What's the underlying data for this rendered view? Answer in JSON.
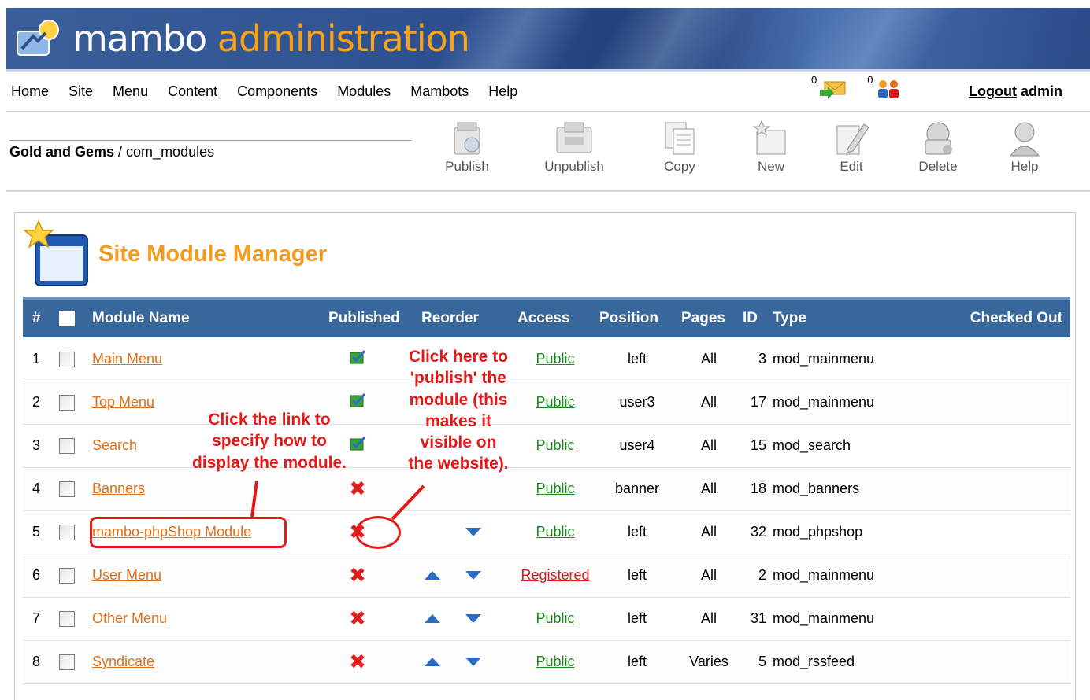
{
  "header": {
    "title_prefix": "mambo ",
    "title_accent": "administration"
  },
  "menu": {
    "items": [
      "Home",
      "Site",
      "Menu",
      "Content",
      "Components",
      "Modules",
      "Mambots",
      "Help"
    ],
    "messages_count": "0",
    "users_count": "0",
    "logout_link": "Logout",
    "logout_user": " admin"
  },
  "pathway": {
    "site": "Gold and Gems",
    "sep": " / ",
    "component": "com_modules"
  },
  "toolbar": {
    "publish": "Publish",
    "unpublish": "Unpublish",
    "copy": "Copy",
    "new": "New",
    "edit": "Edit",
    "delete": "Delete",
    "help": "Help"
  },
  "page_title": "Site Module Manager",
  "table": {
    "headers": {
      "num": "#",
      "name": "Module Name",
      "published": "Published",
      "reorder": "Reorder",
      "access": "Access",
      "position": "Position",
      "pages": "Pages",
      "id": "ID",
      "type": "Type",
      "checked_out": "Checked Out"
    },
    "rows": [
      {
        "num": "1",
        "name": "Main Menu",
        "published": true,
        "up": false,
        "down": false,
        "access": "Public",
        "position": "left",
        "pages": "All",
        "id": "3",
        "type": "mod_mainmenu"
      },
      {
        "num": "2",
        "name": "Top Menu",
        "published": true,
        "up": false,
        "down": false,
        "access": "Public",
        "position": "user3",
        "pages": "All",
        "id": "17",
        "type": "mod_mainmenu"
      },
      {
        "num": "3",
        "name": "Search",
        "published": true,
        "up": false,
        "down": false,
        "access": "Public",
        "position": "user4",
        "pages": "All",
        "id": "15",
        "type": "mod_search"
      },
      {
        "num": "4",
        "name": "Banners",
        "published": false,
        "up": false,
        "down": false,
        "access": "Public",
        "position": "banner",
        "pages": "All",
        "id": "18",
        "type": "mod_banners"
      },
      {
        "num": "5",
        "name": "mambo-phpShop Module",
        "published": false,
        "up": false,
        "down": true,
        "access": "Public",
        "position": "left",
        "pages": "All",
        "id": "32",
        "type": "mod_phpshop"
      },
      {
        "num": "6",
        "name": "User Menu",
        "published": false,
        "up": true,
        "down": true,
        "access": "Registered",
        "position": "left",
        "pages": "All",
        "id": "2",
        "type": "mod_mainmenu"
      },
      {
        "num": "7",
        "name": "Other Menu",
        "published": false,
        "up": true,
        "down": true,
        "access": "Public",
        "position": "left",
        "pages": "All",
        "id": "31",
        "type": "mod_mainmenu"
      },
      {
        "num": "8",
        "name": "Syndicate",
        "published": false,
        "up": true,
        "down": true,
        "access": "Public",
        "position": "left",
        "pages": "Varies",
        "id": "5",
        "type": "mod_rssfeed"
      }
    ]
  },
  "annotations": {
    "link_note": [
      "Click the link to",
      "specify how to",
      "display the module."
    ],
    "publish_note": [
      "Click here to",
      "'publish' the",
      "module (this",
      "makes it",
      "visible on",
      "the website)."
    ]
  },
  "colors": {
    "accent": "#f39b1d",
    "header_row": "#37679b",
    "annotation": "#e81818",
    "public": "#1a8a1a",
    "registered": "#d41a1a"
  }
}
